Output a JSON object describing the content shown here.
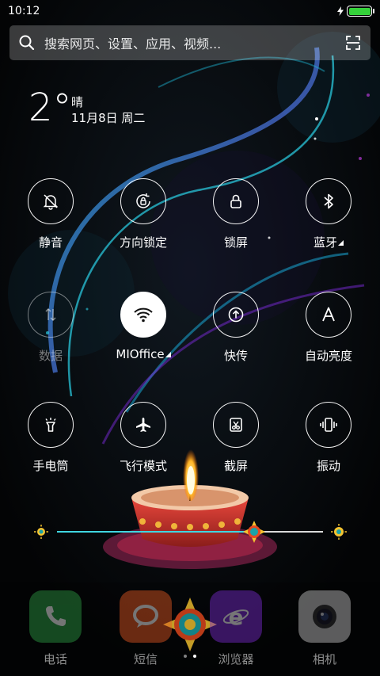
{
  "status_bar": {
    "time": "10:12",
    "battery_level": 1.0
  },
  "search": {
    "placeholder": "搜索网页、设置、应用、视频..."
  },
  "weather": {
    "temperature": "2°",
    "condition": "晴",
    "date": "11月8日 周二"
  },
  "toggles": [
    {
      "label": "静音",
      "icon": "bell-off-icon",
      "state": "off"
    },
    {
      "label": "方向锁定",
      "icon": "rotation-lock-icon",
      "state": "off"
    },
    {
      "label": "锁屏",
      "icon": "lock-icon",
      "state": "off"
    },
    {
      "label": "蓝牙",
      "icon": "bluetooth-icon",
      "state": "off",
      "expandable": true
    },
    {
      "label": "数据",
      "icon": "data-icon",
      "state": "disabled"
    },
    {
      "label": "MIOffice",
      "icon": "wifi-icon",
      "state": "on",
      "expandable": true
    },
    {
      "label": "快传",
      "icon": "quick-transfer-icon",
      "state": "off"
    },
    {
      "label": "自动亮度",
      "icon": "auto-brightness-icon",
      "state": "off"
    },
    {
      "label": "手电筒",
      "icon": "flashlight-icon",
      "state": "off"
    },
    {
      "label": "飞行模式",
      "icon": "airplane-icon",
      "state": "off"
    },
    {
      "label": "截屏",
      "icon": "screenshot-icon",
      "state": "off"
    },
    {
      "label": "振动",
      "icon": "vibrate-icon",
      "state": "off"
    }
  ],
  "brightness": {
    "level": 0.74
  },
  "dock": [
    {
      "label": "电话",
      "icon": "phone-icon",
      "color": "#2e9e44"
    },
    {
      "label": "短信",
      "icon": "message-icon",
      "color": "#e85a22"
    },
    {
      "label": "浏览器",
      "icon": "browser-icon",
      "color": "#7b2bd1"
    },
    {
      "label": "相机",
      "icon": "camera-icon",
      "color": "#c9c9c9"
    }
  ],
  "pager": {
    "pages": 2,
    "current": 2
  },
  "colors": {
    "accent": "#3fd6e0",
    "battery": "#35d23a"
  }
}
